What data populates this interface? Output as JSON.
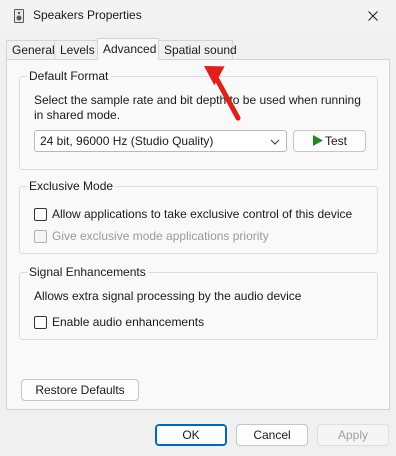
{
  "window": {
    "title": "Speakers Properties"
  },
  "tabs": [
    {
      "label": "General"
    },
    {
      "label": "Levels"
    },
    {
      "label": "Advanced"
    },
    {
      "label": "Spatial sound"
    }
  ],
  "default_format": {
    "title": "Default Format",
    "description_line1": "Select the sample rate and bit depth to be used when running",
    "description_line2": "in shared mode.",
    "selected_format": "24 bit, 96000 Hz (Studio Quality)",
    "test_label": "Test"
  },
  "exclusive_mode": {
    "title": "Exclusive Mode",
    "allow_control_label": "Allow applications to take exclusive control of this device",
    "priority_label": "Give exclusive mode applications priority"
  },
  "signal_enhancements": {
    "title": "Signal Enhancements",
    "description": "Allows extra signal processing by the audio device",
    "enable_label": "Enable audio enhancements"
  },
  "restore_label": "Restore Defaults",
  "footer": {
    "ok": "OK",
    "cancel": "Cancel",
    "apply": "Apply"
  },
  "colors": {
    "annotation_arrow": "#e0201e",
    "test_icon": "#1f8a1f",
    "accent": "#0067c0"
  }
}
